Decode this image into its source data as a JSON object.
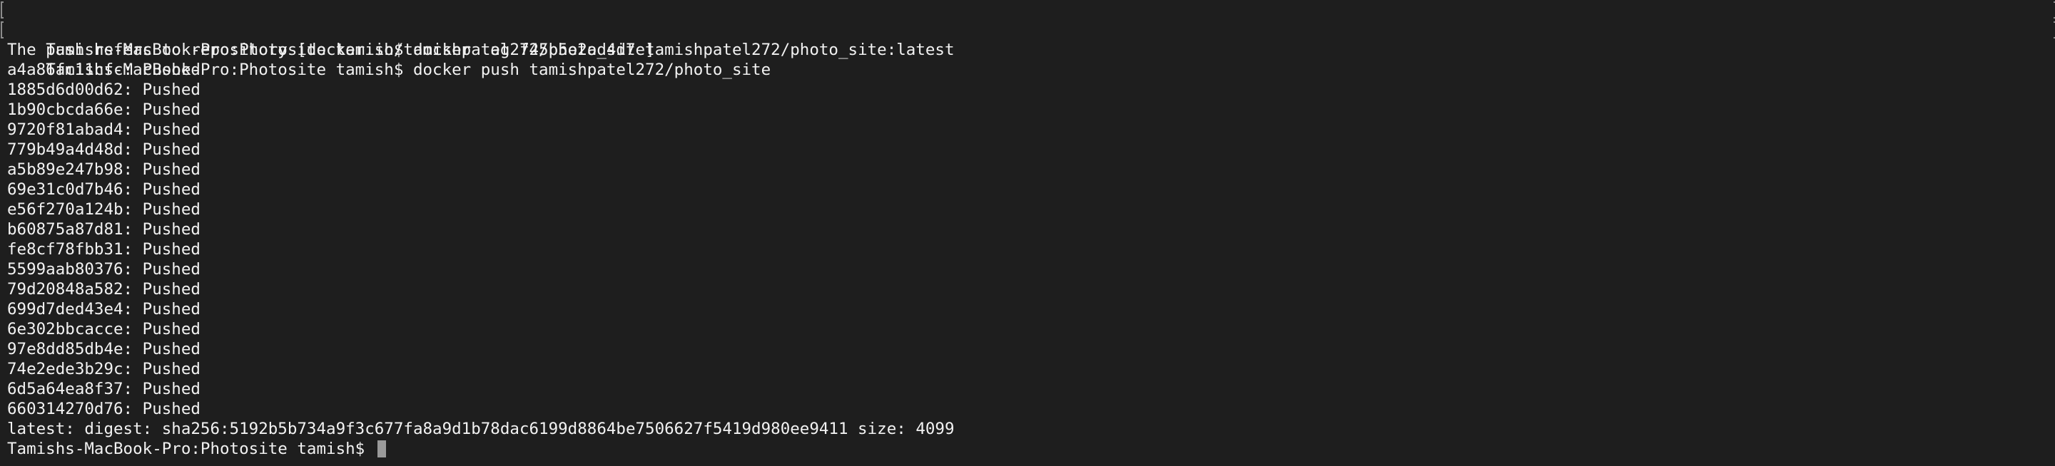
{
  "terminal": {
    "lines": [
      "Tamishs-MacBook-Pro:Photosite tamish$ docker tag f45b5e2ad4d7 tamishpatel272/photo_site:latest",
      "Tamishs-MacBook-Pro:Photosite tamish$ docker push tamishpatel272/photo_site",
      "The push refers to repository [docker.io/tamishpatel272/photo_site]",
      "a4a86fc11cfc: Pushed",
      "1885d6d00d62: Pushed",
      "1b90cbcda66e: Pushed",
      "9720f81abad4: Pushed",
      "779b49a4d48d: Pushed",
      "a5b89e247b98: Pushed",
      "69e31c0d7b46: Pushed",
      "e56f270a124b: Pushed",
      "b60875a87d81: Pushed",
      "fe8cf78fbb31: Pushed",
      "5599aab80376: Pushed",
      "79d20848a582: Pushed",
      "699d7ded43e4: Pushed",
      "6e302bbcacce: Pushed",
      "97e8dd85db4e: Pushed",
      "74e2ede3b29c: Pushed",
      "6d5a64ea8f37: Pushed",
      "660314270d76: Pushed",
      "latest: digest: sha256:5192b5b734a9f3c677fa8a9d1b78dac6199d8864be7506627f5419d980ee9411 size: 4099"
    ],
    "prompt": "Tamishs-MacBook-Pro:Photosite tamish$ ",
    "colors": {
      "background": "#1e1e1e",
      "text": "#f2f2f2",
      "cursor": "#9a9a9a"
    }
  }
}
